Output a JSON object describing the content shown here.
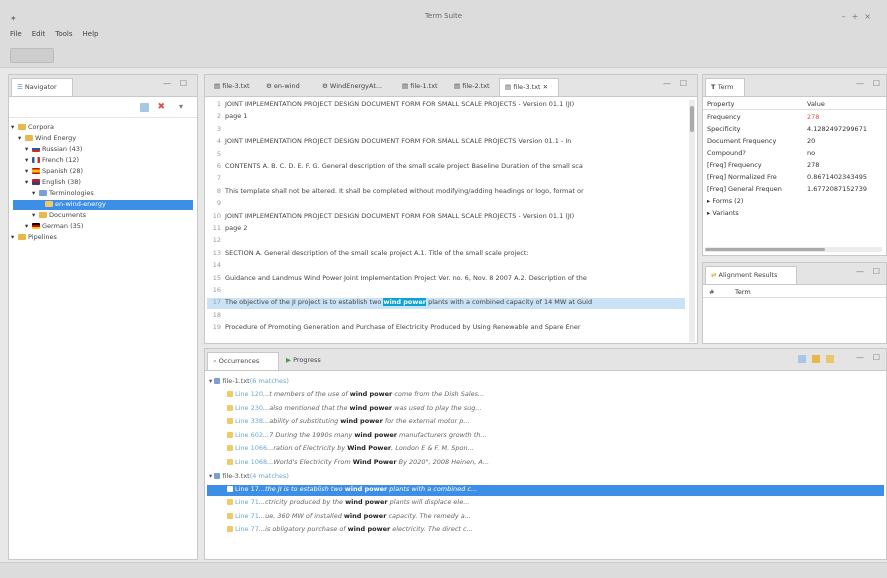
{
  "window": {
    "title": "Term Suite"
  },
  "menu": [
    "File",
    "Edit",
    "Tools",
    "Help"
  ],
  "navigator": {
    "tab_label": "Navigator",
    "tree": [
      {
        "label": "Corpora",
        "depth": 0,
        "icon": "folder"
      },
      {
        "label": "Wind Energy",
        "depth": 1,
        "icon": "folder"
      },
      {
        "label": "Russian (43)",
        "depth": 2,
        "icon": "flag-ru"
      },
      {
        "label": "French (12)",
        "depth": 2,
        "icon": "flag-fr"
      },
      {
        "label": "Spanish (28)",
        "depth": 2,
        "icon": "flag-es"
      },
      {
        "label": "English (38)",
        "depth": 2,
        "icon": "flag-en"
      },
      {
        "label": "Terminologies",
        "depth": 3,
        "icon": "termino"
      },
      {
        "label": "en-wind-energy",
        "depth": 4,
        "icon": "file",
        "selected": true
      },
      {
        "label": "Documents",
        "depth": 3,
        "icon": "folder"
      },
      {
        "label": "German (35)",
        "depth": 2,
        "icon": "flag-de"
      },
      {
        "label": "Pipelines",
        "depth": 0,
        "icon": "folder"
      }
    ]
  },
  "editor": {
    "tabs": [
      "file-3.txt",
      "en-wind",
      "WindEnergyAt...",
      "file-1.txt",
      "file-2.txt",
      "file-3.txt"
    ],
    "active_tab": 5,
    "lines": [
      {
        "n": "1",
        "pre": "JOINT IMPLEMENTATION PROJECT DESIGN DOCUMENT FORM FOR SMALL SCALE PROJECTS - Version 01.1 (JI)",
        "kw": "",
        "post": ""
      },
      {
        "n": "2",
        "pre": "page 1",
        "kw": "",
        "post": ""
      },
      {
        "n": "3",
        "pre": "",
        "kw": "",
        "post": ""
      },
      {
        "n": "4",
        "pre": "JOINT IMPLEMENTATION PROJECT DESIGN DOCUMENT FORM FOR SMALL SCALE PROJECTS Version 01.1 - In",
        "kw": "",
        "post": ""
      },
      {
        "n": "5",
        "pre": "",
        "kw": "",
        "post": ""
      },
      {
        "n": "6",
        "pre": "CONTENTS A. B. C. D. E. F. G. General description of the small scale project Baseline Duration of the small sca",
        "kw": "",
        "post": ""
      },
      {
        "n": "7",
        "pre": "",
        "kw": "",
        "post": ""
      },
      {
        "n": "8",
        "pre": "This template shall not be altered. It shall be completed without modifying/adding headings or logo, format or",
        "kw": "",
        "post": ""
      },
      {
        "n": "9",
        "pre": "",
        "kw": "",
        "post": ""
      },
      {
        "n": "10",
        "pre": "JOINT IMPLEMENTATION PROJECT DESIGN DOCUMENT FORM FOR SMALL SCALE PROJECTS - Version 01.1 (JI)",
        "kw": "",
        "post": ""
      },
      {
        "n": "11",
        "pre": "page 2",
        "kw": "",
        "post": ""
      },
      {
        "n": "12",
        "pre": "",
        "kw": "",
        "post": ""
      },
      {
        "n": "13",
        "pre": "SECTION A. General description of the small scale project A.1. Title of the small scale project:",
        "kw": "",
        "post": ""
      },
      {
        "n": "14",
        "pre": "",
        "kw": "",
        "post": ""
      },
      {
        "n": "15",
        "pre": "Guidance and Landmus Wind Power Joint Implementation Project Ver. no. 6, Nov. 8 2007 A.2. Description of the",
        "kw": "",
        "post": ""
      },
      {
        "n": "16",
        "pre": "",
        "kw": "",
        "post": ""
      },
      {
        "n": "17",
        "pre": "The objective of the JI project is to establish two ",
        "kw": "wind power",
        "post": " plants with a combined capacity of 14 MW at Guid",
        "highlight": true
      },
      {
        "n": "18",
        "pre": "",
        "kw": "",
        "post": ""
      },
      {
        "n": "19",
        "pre": "Procedure of Promoting Generation and Purchase of Electricity Produced by Using Renewable and Spare Ener",
        "kw": "",
        "post": ""
      }
    ]
  },
  "term_panel": {
    "tab_label": "Term",
    "headers": [
      "Property",
      "Value"
    ],
    "rows": [
      {
        "k": "Frequency",
        "v": "278"
      },
      {
        "k": "Specificity",
        "v": "4.1282497299671"
      },
      {
        "k": "Document Frequency",
        "v": "20"
      },
      {
        "k": "Compound?",
        "v": "no"
      },
      {
        "k": "[Freq] Frequency",
        "v": "278"
      },
      {
        "k": "[Freq] Normalized Fre",
        "v": "0.8671402343495"
      },
      {
        "k": "[Freq] General Frequen",
        "v": "1.6772087152739"
      }
    ],
    "groups": [
      "Forms (2)",
      "Variants"
    ]
  },
  "alignment": {
    "tab_label": "Alignment Results",
    "headers": [
      "#",
      "Term"
    ]
  },
  "occurrences": {
    "tabs": [
      "Occurrences",
      "Progress"
    ],
    "groups": [
      {
        "file": "file-1.txt",
        "count": "(6 matches)",
        "items": [
          {
            "link": "Line 120",
            "pre": "...t members of the use of ",
            "kw": "wind power",
            "post": " come from the Dish Sales..."
          },
          {
            "link": "Line 230",
            "pre": "...also mentioned that the ",
            "kw": "wind power",
            "post": " was used to play the sug..."
          },
          {
            "link": "Line 338",
            "pre": "...ability of substituting ",
            "kw": "wind power",
            "post": " for the external motor p..."
          },
          {
            "link": "Line 602",
            "pre": "...7 During the 1990s many ",
            "kw": "wind power",
            "post": " manufacturers growth th..."
          },
          {
            "link": "Line 1066",
            "pre": "...ration of Electricity by ",
            "kw": "Wind Power",
            "post": ", London E & F. M. Spon..."
          },
          {
            "link": "Line 1068",
            "pre": "...World's Electricity From ",
            "kw": "Wind Power",
            "post": " By 2020\", 2008 Heinen, A..."
          }
        ]
      },
      {
        "file": "file-3.txt",
        "count": "(4 matches)",
        "items": [
          {
            "link": "Line 17",
            "pre": "...the JI is to establish two ",
            "kw": "wind power",
            "post": " plants with a combined c...",
            "selected": true
          },
          {
            "link": "Line 71",
            "pre": "...ctricity produced by the ",
            "kw": "wind power",
            "post": " plants will displace ele..."
          },
          {
            "link": "Line 71",
            "pre": "...ue, 360 MW of installed ",
            "kw": "wind power",
            "post": " capacity. The remedy a..."
          },
          {
            "link": "Line 77",
            "pre": "...is obligatory purchase of ",
            "kw": "wind power",
            "post": " electricity. The direct c..."
          }
        ]
      }
    ]
  }
}
